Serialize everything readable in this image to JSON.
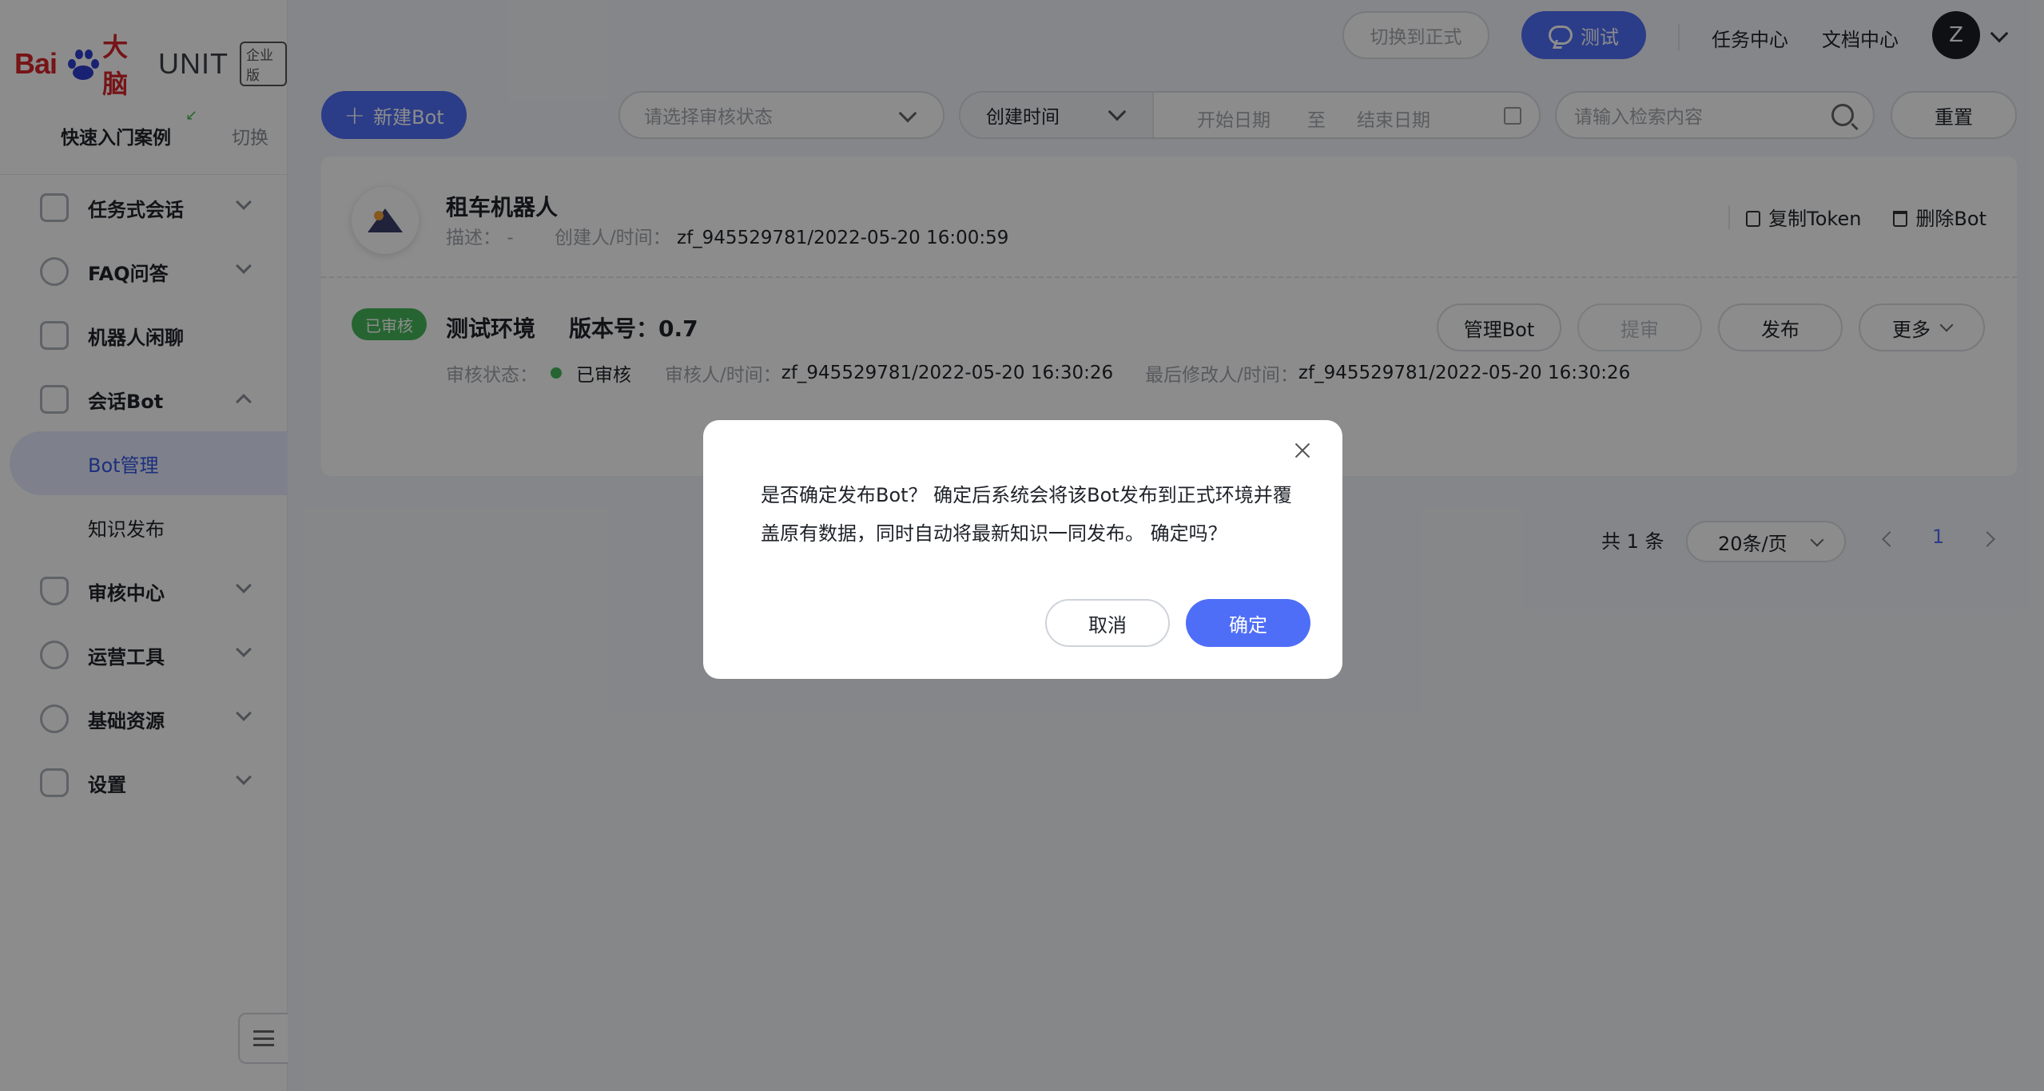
{
  "brand": {
    "logo_bai": "Bai",
    "logo_du": "du",
    "logo_dabrain": "大脑",
    "logo_unit": "UNIT",
    "edition": "企业版",
    "logo_color": "#d7262b"
  },
  "sidebar": {
    "quick_label": "快速入门案例",
    "switch_label": "切换",
    "menu": [
      {
        "label": "任务式会话",
        "icon": "flow-icon",
        "expanded": false
      },
      {
        "label": "FAQ问答",
        "icon": "question-icon",
        "expanded": false
      },
      {
        "label": "机器人闲聊",
        "icon": "chat-bubble-icon"
      },
      {
        "label": "会话Bot",
        "icon": "bot-icon",
        "expanded": true
      },
      {
        "label": "审核中心",
        "icon": "shield-icon",
        "expanded": false
      },
      {
        "label": "运营工具",
        "icon": "tool-icon",
        "expanded": false
      },
      {
        "label": "基础资源",
        "icon": "cubes-icon",
        "expanded": false
      },
      {
        "label": "设置",
        "icon": "gear-icon",
        "expanded": false
      }
    ],
    "submenu": [
      {
        "label": "Bot管理",
        "active": true
      },
      {
        "label": "知识发布",
        "active": false
      }
    ]
  },
  "header": {
    "switch_formal": "切换到正式",
    "test": "测试",
    "task_center": "任务中心",
    "doc_center": "文档中心",
    "avatar_letter": "Z"
  },
  "filters": {
    "new_bot": "新建Bot",
    "audit_status_placeholder": "请选择审核状态",
    "time_type": "创建时间",
    "start_date": "开始日期",
    "to": "至",
    "end_date": "结束日期",
    "search_placeholder": "请输入检索内容",
    "reset": "重置"
  },
  "bot": {
    "name": "租车机器人",
    "desc_label": "描述：",
    "desc_value": "-",
    "creator_label": "创建人/时间：",
    "creator_value": "zf_945529781/2022-05-20 16:00:59",
    "copy_token": "复制Token",
    "delete_bot": "删除Bot",
    "badge": "已审核",
    "env": "测试环境",
    "version_label": "版本号：",
    "version": "0.7",
    "audit_status_label": "审核状态：",
    "audit_status_value": "已审核",
    "auditor_label": "审核人/时间：",
    "auditor_value": "zf_945529781/2022-05-20 16:30:26",
    "modifier_label": "最后修改人/时间：",
    "modifier_value": "zf_945529781/2022-05-20 16:30:26",
    "manage_bot": "管理Bot",
    "submit_audit": "提审",
    "publish": "发布",
    "more": "更多"
  },
  "pagination": {
    "total": "共 1 条",
    "page_size": "20条/页",
    "current": "1"
  },
  "modal": {
    "text": "是否确定发布Bot？ 确定后系统会将该Bot发布到正式环境并覆盖原有数据，同时自动将最新知识一同发布。 确定吗？",
    "cancel": "取消",
    "confirm": "确定"
  },
  "colors": {
    "primary": "#4f6ef7",
    "success": "#45b85a",
    "overlay": "rgba(0,0,0,0.45)"
  }
}
